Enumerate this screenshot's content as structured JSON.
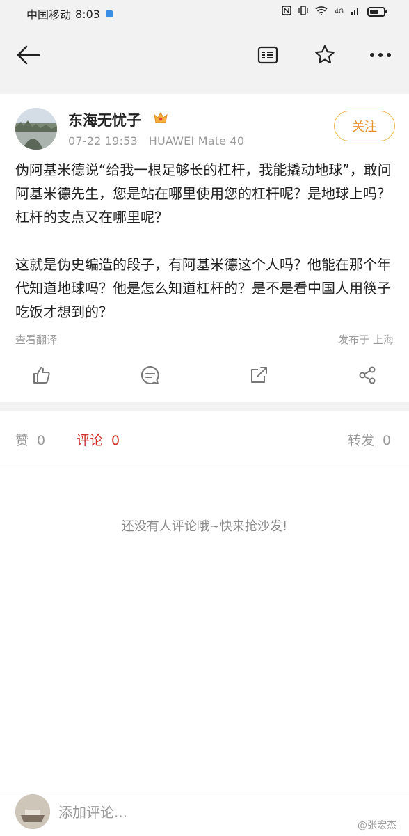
{
  "status_bar": {
    "carrier": "中国移动",
    "time": "8:03",
    "network": "4G"
  },
  "nav": {
    "icons": [
      "back-arrow-icon",
      "document-icon",
      "star-icon",
      "more-icon"
    ]
  },
  "post": {
    "author": "东海无忧子",
    "date": "07-22 19:53",
    "device": "HUAWEI Mate 40",
    "follow_label": "关注",
    "content": "伪阿基米德说“给我一根足够长的杠杆，我能撬动地球”，敢问阿基米德先生，您是站在哪里使用您的杠杆呢？是地球上吗？杠杆的支点又在哪里呢？\n\n这就是伪史编造的段子，有阿基米德这个人吗？他能在那个年代知道地球吗？他是怎么知道杠杆的？是不是看中国人用筷子吃饭才想到的？",
    "translate_label": "查看翻译",
    "location": "发布于 上海",
    "action_icons": [
      "thumb-up-icon",
      "comment-icon",
      "forward-icon",
      "share-icon"
    ]
  },
  "comments": {
    "tabs": [
      {
        "label": "赞",
        "count": "0"
      },
      {
        "label": "评论",
        "count": "0"
      },
      {
        "label": "转发",
        "count": "0"
      }
    ],
    "empty_text": "还没有人评论哦~快来抢沙发!"
  },
  "bottom": {
    "input_placeholder": "添加评论...",
    "watermark": "@张宏杰"
  },
  "colors": {
    "accent_red": "#d0312d",
    "follow_orange": "#e8932c",
    "background": "#f2f2f2"
  }
}
